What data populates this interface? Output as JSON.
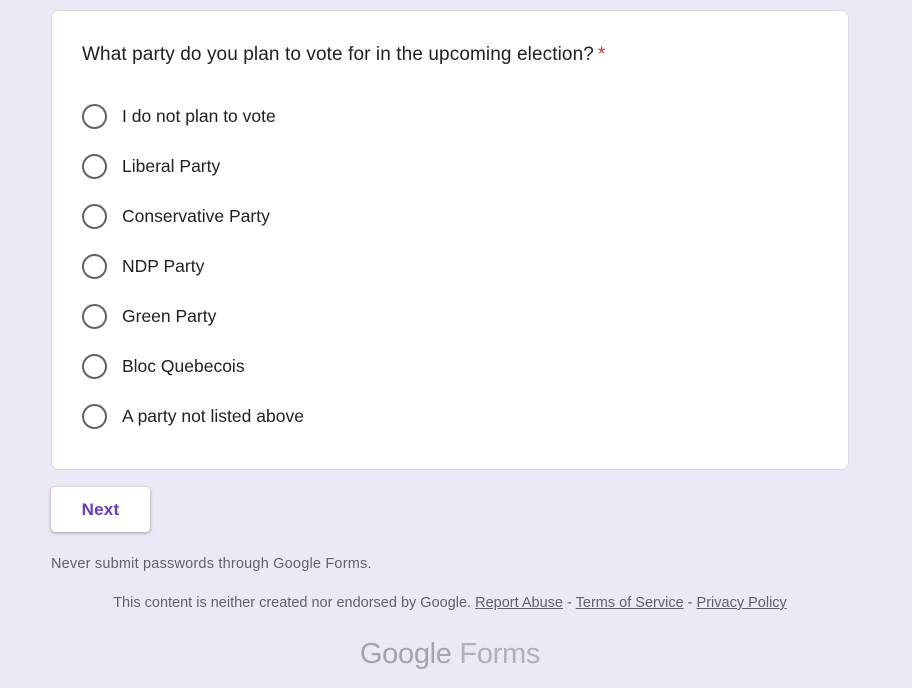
{
  "question": {
    "text": "What party do you plan to vote for in the upcoming election?",
    "required_marker": "*"
  },
  "options": [
    {
      "label": "I do not plan to vote",
      "selected": false
    },
    {
      "label": "Liberal Party",
      "selected": false
    },
    {
      "label": "Conservative Party",
      "selected": false
    },
    {
      "label": "NDP Party",
      "selected": false
    },
    {
      "label": "Green Party",
      "selected": false
    },
    {
      "label": "Bloc Quebecois",
      "selected": false
    },
    {
      "label": "A party not listed above",
      "selected": false
    }
  ],
  "next_button": {
    "label": "Next"
  },
  "warning": "Never submit passwords through Google Forms.",
  "disclaimer": {
    "text": "This content is neither created nor endorsed by Google.",
    "report_abuse": "Report Abuse",
    "separator": "-",
    "terms": "Terms of Service",
    "privacy": "Privacy Policy"
  },
  "footer_logo": {
    "google": "Google",
    "forms": "Forms"
  },
  "colors": {
    "background": "#ede8f5",
    "accent": "#673ab7",
    "required": "#d93025"
  }
}
